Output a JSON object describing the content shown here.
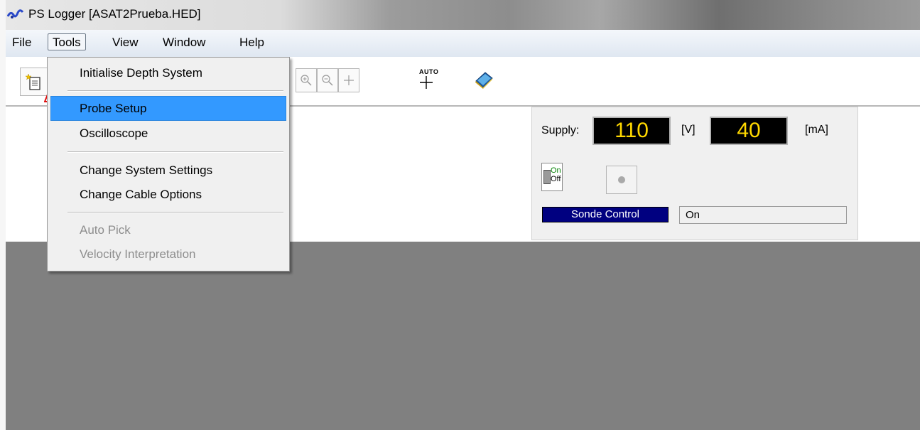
{
  "window": {
    "title": "PS Logger [ASAT2Prueba.HED]"
  },
  "menubar": {
    "items": [
      "File",
      "Tools",
      "View",
      "Window",
      "Help"
    ]
  },
  "tools_menu": {
    "items": [
      {
        "label": "Initialise Depth System",
        "enabled": true
      },
      {
        "label": "Probe Setup",
        "enabled": true,
        "highlighted": true
      },
      {
        "label": "Oscilloscope",
        "enabled": true
      },
      {
        "label": "Change System Settings",
        "enabled": true
      },
      {
        "label": "Change Cable Options",
        "enabled": true
      },
      {
        "label": "Auto Pick",
        "enabled": false
      },
      {
        "label": "Velocity Interpretation",
        "enabled": false
      }
    ]
  },
  "toolbar": {
    "buttons": [
      "new-document-icon",
      "zoom-in-icon",
      "zoom-out-icon",
      "plus-icon",
      "auto-plus-icon",
      "book-icon"
    ],
    "auto_label": "AUTO"
  },
  "supply": {
    "label": "Supply:",
    "voltage": "110",
    "voltage_unit": "[V]",
    "current": "40",
    "current_unit": "[mA]",
    "switch_on": "On",
    "switch_off": "Off",
    "sonde_label": "Sonde Control",
    "sonde_value": "On"
  },
  "colors": {
    "highlight": "#3399ff",
    "lcd_text": "#ffd800",
    "sonde_bg": "#000080",
    "workspace": "#808080"
  }
}
